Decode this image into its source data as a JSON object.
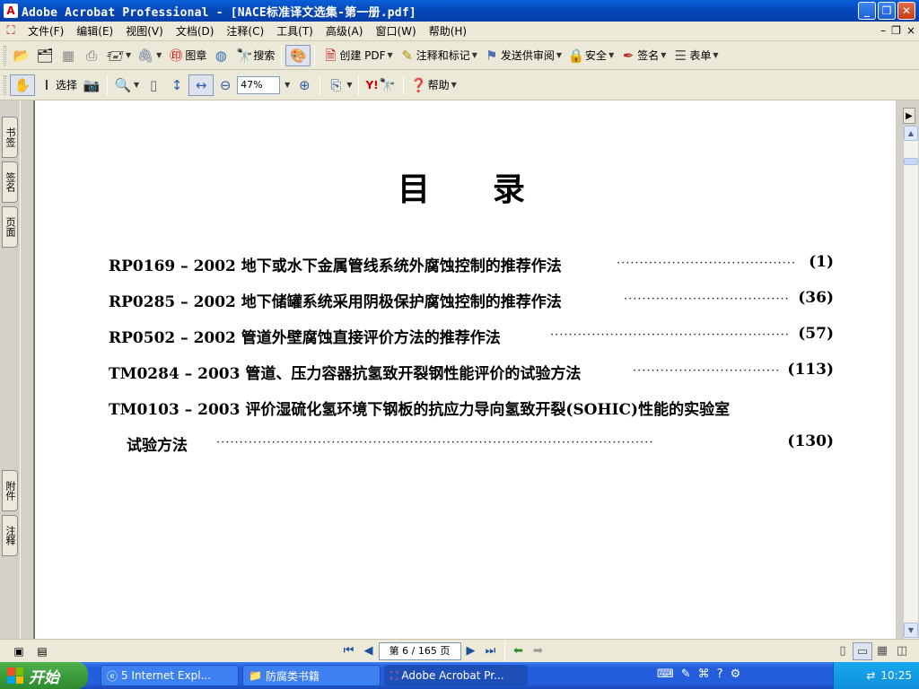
{
  "window": {
    "title": "Adobe Acrobat Professional - [NACE标准译文选集-第一册.pdf]",
    "buttons": {
      "minimize": "_",
      "maximize": "❐",
      "close": "✕"
    }
  },
  "menu": {
    "items": [
      "文件(F)",
      "编辑(E)",
      "视图(V)",
      "文档(D)",
      "注释(C)",
      "工具(T)",
      "高级(A)",
      "窗口(W)",
      "帮助(H)"
    ],
    "doc_buttons": {
      "minimize": "–",
      "restore": "❐",
      "close": "×"
    }
  },
  "toolbar1": {
    "stamp_label": "图章",
    "search_label": "搜索",
    "create_pdf_label": "创建 PDF",
    "comment_label": "注释和标记",
    "review_label": "发送供审阅",
    "security_label": "安全",
    "sign_label": "签名",
    "forms_label": "表单"
  },
  "toolbar2": {
    "select_label": "选择",
    "zoom_value": "47%",
    "yahoo_label": "Y!",
    "help_label": "帮助"
  },
  "left_tabs": {
    "bookmarks": "书签",
    "signatures": "签名",
    "pages": "页面",
    "attachments": "附件",
    "comments": "注释"
  },
  "document": {
    "title": "目录",
    "toc": [
      {
        "text": "RP0169 – 2002 地下或水下金属管线系统外腐蚀控制的推荐作法",
        "page": "(1)"
      },
      {
        "text": "RP0285 – 2002 地下储罐系统采用阴极保护腐蚀控制的推荐作法",
        "page": "(36)"
      },
      {
        "text": "RP0502 – 2002 管道外壁腐蚀直接评价方法的推荐作法",
        "page": "(57)"
      },
      {
        "text": "TM0284 – 2003 管道、压力容器抗氢致开裂钢性能评价的试验方法",
        "page": "(113)"
      },
      {
        "text": "TM0103 – 2003 评价湿硫化氢环境下钢板的抗应力导向氢致开裂(SOHIC)性能的实验室",
        "page": ""
      },
      {
        "text": "试验方法",
        "page": "(130)"
      }
    ],
    "dots": "·······························································································"
  },
  "statusbar": {
    "page_indicator": "第 6 / 165 页"
  },
  "taskbar": {
    "start_label": "开始",
    "tasks": [
      "5 Internet Expl...",
      "防腐类书籍",
      "Adobe Acrobat Pr..."
    ],
    "clock": "10:25"
  }
}
